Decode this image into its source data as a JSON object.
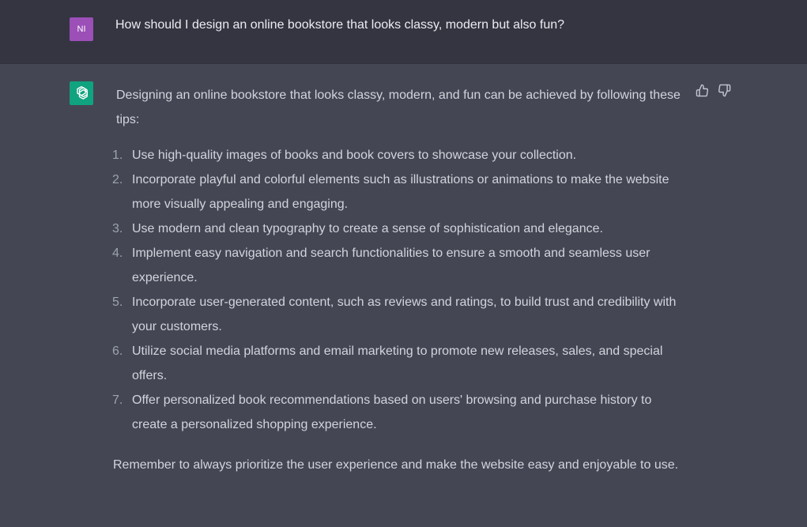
{
  "user_message": {
    "avatar_initials": "NI",
    "text": "How should I design an online bookstore that looks classy, modern but also fun?"
  },
  "assistant_message": {
    "avatar_icon": "openai-logo-icon",
    "intro": "Designing an online bookstore that looks classy, modern, and fun can be achieved by following these tips:",
    "tips": [
      {
        "num": "1.",
        "text": "Use high-quality images of books and book covers to showcase your collection."
      },
      {
        "num": "2.",
        "text": "Incorporate playful and colorful elements such as illustrations or animations to make the website more visually appealing and engaging."
      },
      {
        "num": "3.",
        "text": "Use modern and clean typography to create a sense of sophistication and elegance."
      },
      {
        "num": "4.",
        "text": "Implement easy navigation and search functionalities to ensure a smooth and seamless user experience."
      },
      {
        "num": "5.",
        "text": "Incorporate user-generated content, such as reviews and ratings, to build trust and credibility with your customers."
      },
      {
        "num": "6.",
        "text": "Utilize social media platforms and email marketing to promote new releases, sales, and special offers."
      },
      {
        "num": "7.",
        "text": "Offer personalized book recommendations based on users' browsing and purchase history to create a personalized shopping experience."
      }
    ],
    "outro": "Remember to always prioritize the user experience and make the website easy and enjoyable to use."
  },
  "feedback": {
    "thumbs_up_icon": "thumbs-up-icon",
    "thumbs_down_icon": "thumbs-down-icon"
  },
  "colors": {
    "user_bg": "#343541",
    "assistant_bg": "#444654",
    "user_avatar": "#9b4fb7",
    "bot_avatar": "#10a37f",
    "text": "#d1d5db"
  }
}
